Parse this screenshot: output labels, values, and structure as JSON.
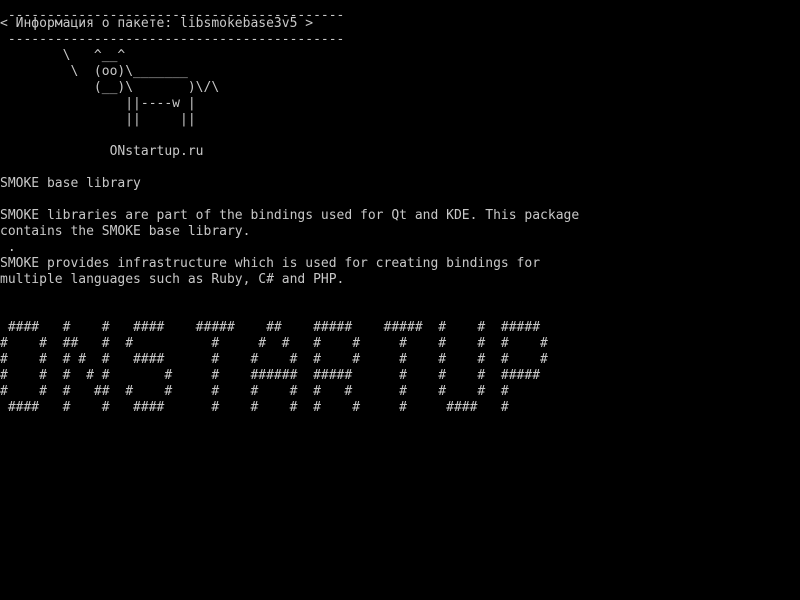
{
  "screen": {
    "lines": [
      " -------------------------------------------",
      "< Информация о пакете: libsmokebase3v5 >",
      " -------------------------------------------",
      "        \\   ^__^",
      "         \\  (oo)\\_______",
      "            (__)\\       )\\/\\",
      "                ||----w |",
      "                ||     ||",
      "",
      "              ONstartup.ru",
      "",
      "SMOKE base library",
      "",
      "SMOKE libraries are part of the bindings used for Qt and KDE. This package",
      "contains the SMOKE base library.",
      " .",
      "SMOKE provides infrastructure which is used for creating bindings for",
      "multiple languages such as Ruby, C# and PHP.",
      "",
      "",
      " ####   #    #   ####    #####    ##    #####    #####  #    #  #####",
      "#    #  ##   #  #          #     #  #   #    #     #    #    #  #    #",
      "#    #  # #  #   ####      #    #    #  #    #     #    #    #  #    #",
      "#    #  #  # #       #     #    ######  #####      #    #    #  #####",
      "#    #  #   ##  #    #     #    #    #  #   #      #    #    #  #",
      " ####   #    #   ####      #    #    #  #    #     #     ####   #"
    ]
  }
}
